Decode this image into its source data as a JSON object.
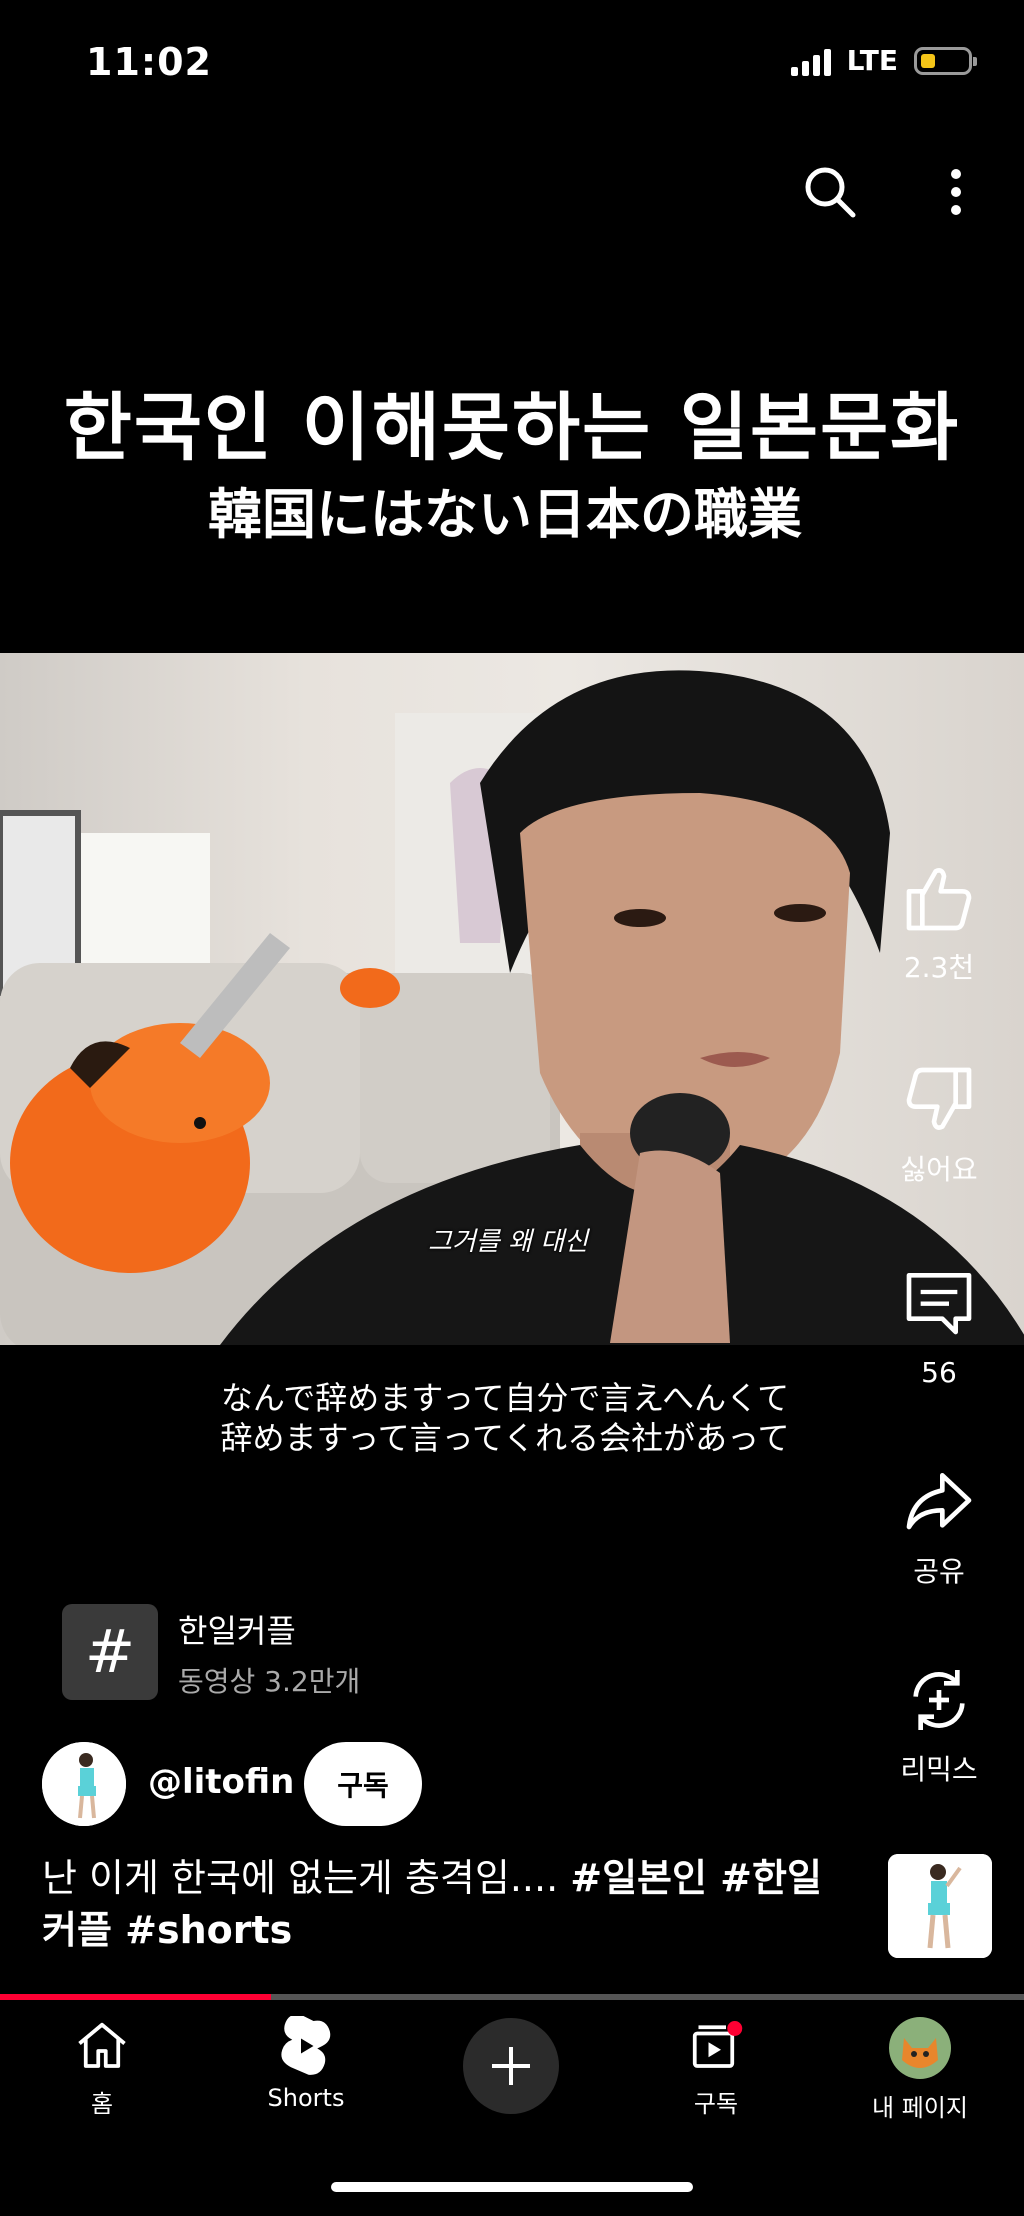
{
  "status_bar": {
    "time": "11:02",
    "network": "LTE"
  },
  "overlay": {
    "title_ko": "한국인 이해못하는 일본문화",
    "title_jp": "韓国にはない日本の職業"
  },
  "video": {
    "burned_subtitle_ko": "그거를 왜 대신",
    "subtitle_jp_line1": "なんで辞めますって自分で言えへんくて",
    "subtitle_jp_line2": "辞めますって言ってくれる会社があって"
  },
  "actions": {
    "like": "2.3천",
    "dislike": "싫어요",
    "comments": "56",
    "share": "공유",
    "remix": "리믹스"
  },
  "hashtag": {
    "title": "한일커플",
    "subtitle": "동영상 3.2만개"
  },
  "channel": {
    "handle": "@litofin",
    "subscribe_label": "구독"
  },
  "description": {
    "text": "난 이게 한국에 없는게 충격임.... ",
    "tags_line1": "#일본인 #한일",
    "tags_line2": "커플 #shorts"
  },
  "playback": {
    "progress": 0.265
  },
  "bottom_nav": {
    "home": "홈",
    "shorts": "Shorts",
    "subscriptions": "구독",
    "my_page": "내 페이지"
  },
  "colors": {
    "accent": "#ff0033",
    "battery": "#f5c518"
  }
}
